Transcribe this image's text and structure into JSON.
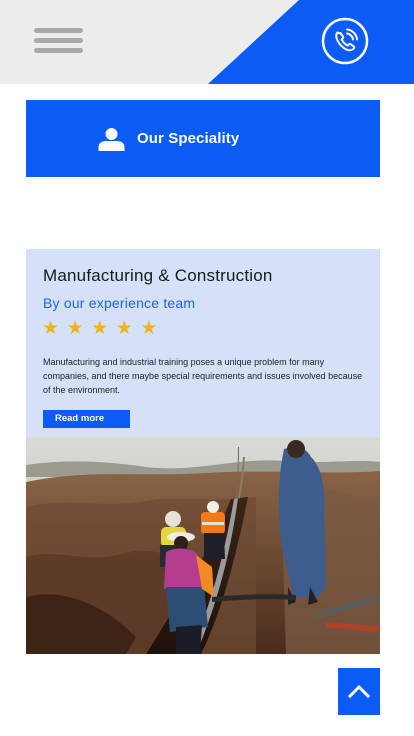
{
  "header": {
    "menu_icon": "hamburger-menu-icon",
    "phone_icon": "phone-call-icon",
    "accent_color": "#0a5cf5",
    "background_color": "#ececec"
  },
  "specialty": {
    "icon": "user-icon",
    "label": "Our Speciality"
  },
  "service_card": {
    "title": "Manufacturing & Construction",
    "subtitle": "By our experience team",
    "rating": 5,
    "rating_max": 5,
    "star_glyph": "★",
    "description": "Manufacturing and industrial training poses a unique problem for many companies, and there maybe special requirements and issues involved because of the environment.",
    "read_more": "Read more",
    "photo_subject": "workers in a trench at a construction site"
  },
  "scroll_to_top": {
    "icon": "chevron-up-icon"
  }
}
